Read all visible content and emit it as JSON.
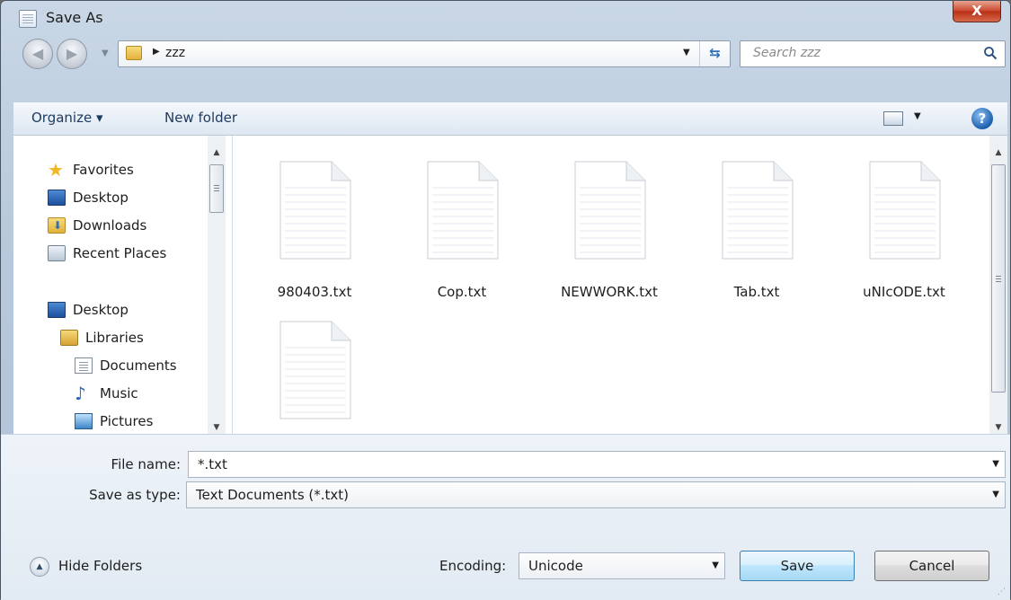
{
  "window": {
    "title": "Save As",
    "close_label": "X"
  },
  "address_bar": {
    "path": "zzz",
    "separator": "▶"
  },
  "search": {
    "placeholder": "Search zzz"
  },
  "command_bar": {
    "organize_label": "Organize ▾",
    "new_folder_label": "New folder"
  },
  "nav_pane": {
    "items": [
      {
        "label": "Favorites",
        "icon": "star-icon"
      },
      {
        "label": "Desktop",
        "icon": "desktop-icon"
      },
      {
        "label": "Downloads",
        "icon": "downloads-icon"
      },
      {
        "label": "Recent Places",
        "icon": "recent-places-icon"
      },
      {
        "label": "Desktop",
        "icon": "desktop-icon"
      },
      {
        "label": "Libraries",
        "icon": "libraries-icon"
      },
      {
        "label": "Documents",
        "icon": "documents-icon"
      },
      {
        "label": "Music",
        "icon": "music-icon"
      },
      {
        "label": "Pictures",
        "icon": "pictures-icon"
      }
    ]
  },
  "files": [
    {
      "name": "980403.txt"
    },
    {
      "name": "Cop.txt"
    },
    {
      "name": "NEWWORK.txt"
    },
    {
      "name": "Tab.txt"
    },
    {
      "name": "uNIcODE.txt"
    },
    {
      "name": ""
    }
  ],
  "form": {
    "file_name_label": "File name:",
    "file_name_value": "*.txt",
    "save_type_label": "Save as type:",
    "save_type_value": "Text Documents (*.txt)",
    "encoding_label": "Encoding:",
    "encoding_value": "Unicode"
  },
  "footer": {
    "hide_folders_label": "Hide Folders",
    "save_label": "Save",
    "cancel_label": "Cancel"
  },
  "colors": {
    "accent": "#2e6fb6",
    "close_button": "#c9452b"
  }
}
